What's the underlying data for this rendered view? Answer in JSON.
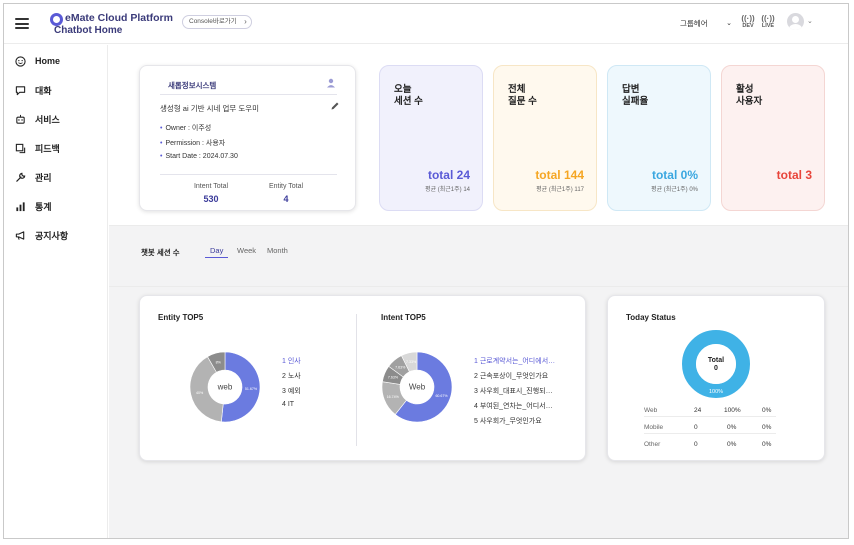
{
  "header": {
    "brand_title": "eMate Cloud Platform",
    "brand_sub": "Chatbot Home",
    "console_button": "Console바로가기",
    "group_select": "그룹헤어",
    "env_dev": "DEV",
    "env_live": "LIVE"
  },
  "sidebar": {
    "items": [
      {
        "label": "Home",
        "icon": "smile-icon"
      },
      {
        "label": "대화",
        "icon": "chat-icon"
      },
      {
        "label": "서비스",
        "icon": "robot-icon"
      },
      {
        "label": "피드백",
        "icon": "feedback-icon"
      },
      {
        "label": "관리",
        "icon": "wrench-icon"
      },
      {
        "label": "통계",
        "icon": "bar-chart-icon"
      },
      {
        "label": "공지사항",
        "icon": "megaphone-icon"
      }
    ]
  },
  "bot": {
    "name": "새롭정보시스템",
    "description": "생성형 ai 기반 시네 업무 도우미",
    "owner": "Owner : 이주성",
    "permission": "Permission : 사용자",
    "start_date": "Start Date : 2024.07.30",
    "intent_label": "Intent Total",
    "intent_value": "530",
    "entity_label": "Entity Total",
    "entity_value": "4"
  },
  "kpis": [
    {
      "title": "오늘\n세션 수",
      "total": "total 24",
      "sub": "평균 (최근1주) 14",
      "color": "#5a5ad6",
      "bg": "#f1f1fc",
      "border": "#dcdcf4"
    },
    {
      "title": "전체\n질문 수",
      "total": "total 144",
      "sub": "평균 (최근1주) 117",
      "color": "#f5a623",
      "bg": "#fff9ee",
      "border": "#f7e6c6"
    },
    {
      "title": "답변\n실패율",
      "total": "total 0%",
      "sub": "평균 (최근1주) 0%",
      "color": "#3aa7e0",
      "bg": "#eef8fd",
      "border": "#cfe8f5"
    },
    {
      "title": "활성\n사용자",
      "total": "total 3",
      "sub": "",
      "color": "#e8443a",
      "bg": "#fdf1f0",
      "border": "#f4d6d3"
    }
  ],
  "session": {
    "title": "챗봇 세션 수",
    "tabs": [
      "Day",
      "Week",
      "Month"
    ]
  },
  "entity_top5": {
    "title": "Entity TOP5",
    "center": "web",
    "items": [
      "1 인사",
      "2 노사",
      "3 예외",
      "4 IT"
    ],
    "slices": [
      {
        "label": "51.67%",
        "value": 51.67,
        "color": "#6b7be0"
      },
      {
        "label": "40%",
        "value": 40,
        "color": "#b3b3b3"
      },
      {
        "label": "8%",
        "value": 8.33,
        "color": "#8c8c8c"
      }
    ]
  },
  "intent_top5": {
    "title": "Intent TOP5",
    "center": "Web",
    "items": [
      "1 근로계약서는_어디에서…",
      "2 근속포상이_무엇인가요",
      "3 사우회_대표시_진행되…",
      "4 부여된_연차는_어디서…",
      "5 사우회가_무엇인가요"
    ],
    "slices": [
      {
        "label": "60.67%",
        "value": 60.67,
        "color": "#6b7be0"
      },
      {
        "label": "16.74%",
        "value": 16.74,
        "color": "#b3b3b3"
      },
      {
        "label": "7.63%",
        "value": 7.63,
        "color": "#8c8c8c"
      },
      {
        "label": "7.63%",
        "value": 7.63,
        "color": "#a0a0a0"
      },
      {
        "label": "7.33%",
        "value": 7.33,
        "color": "#d8d8d8"
      }
    ]
  },
  "today_status": {
    "title": "Today Status",
    "center_label": "Total",
    "center_value": "0",
    "ring_label": "100%",
    "ring_color": "#3fb2e6",
    "rows": [
      {
        "label": "Web",
        "c1": "24",
        "c2": "100%",
        "c3": "0%"
      },
      {
        "label": "Mobile",
        "c1": "0",
        "c2": "0%",
        "c3": "0%"
      },
      {
        "label": "Other",
        "c1": "0",
        "c2": "0%",
        "c3": "0%"
      }
    ]
  }
}
